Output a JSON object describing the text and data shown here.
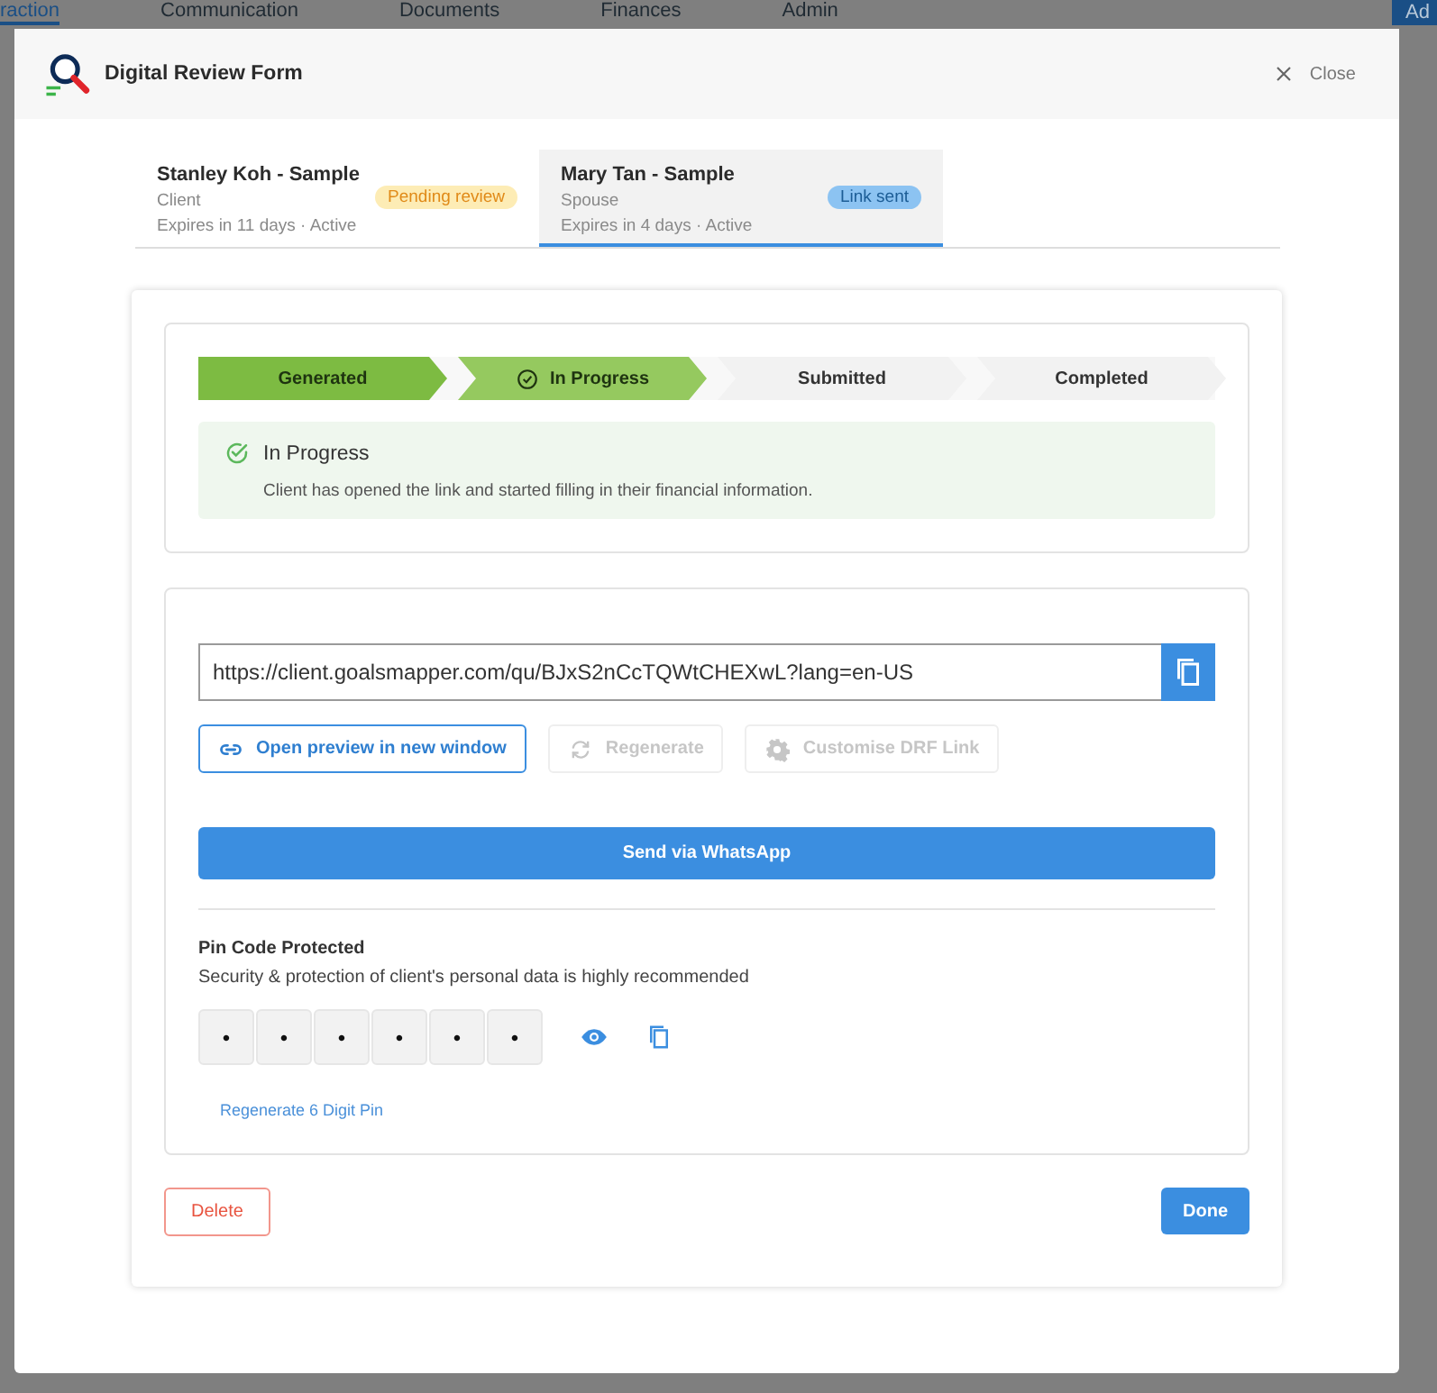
{
  "backdrop": {
    "nav": [
      {
        "label": "raction",
        "selected": true
      },
      {
        "label": "Communication",
        "selected": false
      },
      {
        "label": "Documents",
        "selected": false
      },
      {
        "label": "Finances",
        "selected": false
      },
      {
        "label": "Admin",
        "selected": false
      }
    ],
    "button": "Ad"
  },
  "dialog": {
    "title": "Digital Review Form",
    "close": "Close"
  },
  "people": [
    {
      "name": "Stanley Koh - Sample",
      "role": "Client",
      "expiry": "Expires in 11 days · Active",
      "badge": "Pending review",
      "kind": "pending",
      "selected": false
    },
    {
      "name": "Mary Tan - Sample",
      "role": "Spouse",
      "expiry": "Expires in 4 days · Active",
      "badge": "Link sent",
      "kind": "sent",
      "selected": true
    }
  ],
  "steps": [
    {
      "label": "Generated",
      "kind": "done"
    },
    {
      "label": "In Progress",
      "kind": "current"
    },
    {
      "label": "Submitted",
      "kind": "pending"
    },
    {
      "label": "Completed",
      "kind": "pending"
    }
  ],
  "status": {
    "title": "In Progress",
    "message": "Client has opened the link and started filling in their financial information."
  },
  "link": {
    "value": "https://client.goalsmapper.com/qu/BJxS2nCcTQWtCHEXwL?lang=en-US",
    "actions": [
      {
        "label": "Open preview in new window",
        "disabled": false
      },
      {
        "label": "Regenerate",
        "disabled": true
      },
      {
        "label": "Customise DRF Link",
        "disabled": true
      }
    ],
    "send": "Send via WhatsApp"
  },
  "pin": {
    "title": "Pin Code Protected",
    "description": "Security & protection of client's personal data is highly recommended",
    "digits": [
      "•",
      "•",
      "•",
      "•",
      "•",
      "•"
    ],
    "regenerate": "Regenerate 6 Digit Pin"
  },
  "footer": {
    "delete": "Delete",
    "done": "Done"
  }
}
